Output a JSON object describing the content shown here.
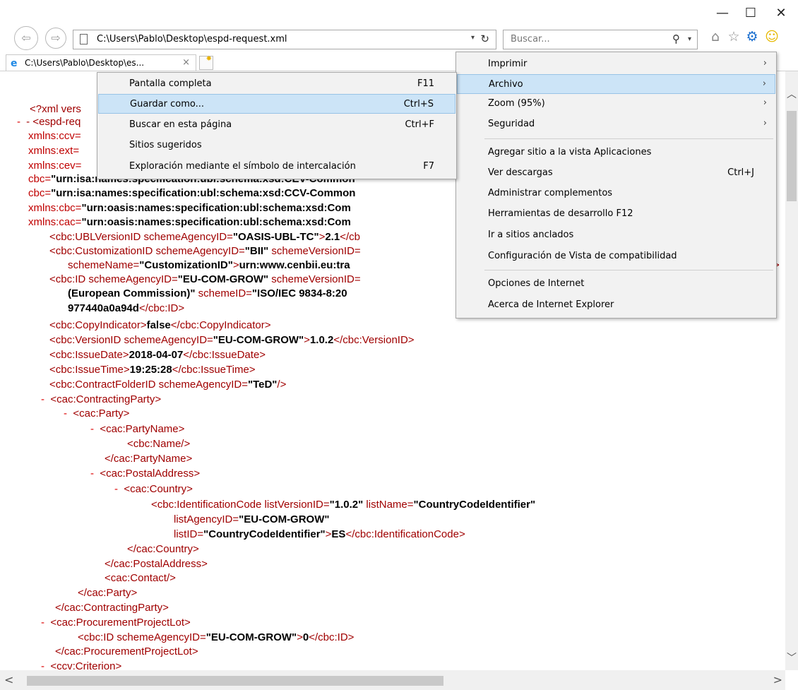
{
  "address_bar": {
    "url": "C:\\Users\\Pablo\\Desktop\\espd-request.xml"
  },
  "search": {
    "placeholder": "Buscar..."
  },
  "tab": {
    "title": "C:\\Users\\Pablo\\Desktop\\es...",
    "close": "×"
  },
  "window": {
    "minimize": "—",
    "maximize": "☐",
    "close": "✕"
  },
  "icons": {
    "back": "⇦",
    "forward": "⇨",
    "refresh": "↻",
    "search": "⚲",
    "dropdown": "▾",
    "home": "⌂",
    "favorites": "☆",
    "tools": "⚙",
    "feedback": "☺"
  },
  "colors": {
    "tag": "#990000",
    "attr": "#c00000",
    "menu_highlight": "#cce4f7"
  },
  "tools_menu": [
    {
      "label": "Imprimir",
      "submenu": true
    },
    {
      "label": "Archivo",
      "submenu": true,
      "highlighted": true
    },
    {
      "label": "Zoom (95%)",
      "submenu": true
    },
    {
      "label": "Seguridad",
      "submenu": true
    },
    {
      "label": "Agregar sitio a la vista Aplicaciones"
    },
    {
      "label": "Ver descargas",
      "shortcut": "Ctrl+J"
    },
    {
      "label": "Administrar complementos"
    },
    {
      "label": "Herramientas de desarrollo F12"
    },
    {
      "label": "Ir a sitios anclados"
    },
    {
      "label": "Configuración de Vista de compatibilidad"
    },
    {
      "label": "Opciones de Internet"
    },
    {
      "label": "Acerca de Internet Explorer"
    }
  ],
  "file_submenu": [
    {
      "label": "Pantalla completa",
      "shortcut": "F11"
    },
    {
      "label": "Guardar como...",
      "shortcut": "Ctrl+S",
      "highlighted": true
    },
    {
      "label": "Buscar en esta página",
      "shortcut": "Ctrl+F"
    },
    {
      "label": "Sitios sugeridos"
    },
    {
      "label": "Exploración mediante el símbolo de intercalación",
      "shortcut": "F7"
    }
  ],
  "xml": {
    "l01": "<?xml vers",
    "l02": "- <espd-req",
    "l03": "xmlns:ccv=",
    "l04": "xmlns:ext=",
    "l05": "xmlns:cev=",
    "l06a": "cbc=",
    "l06b": "\"urn:isa:names:specification:ubl:schema:xsd:CEV-Common",
    "l07a": "cbc=",
    "l07b": "\"urn:isa:names:specification:ubl:schema:xsd:CCV-Common",
    "l08a": "xmlns:cbc=",
    "l08b": "\"urn:oasis:names:specification:ubl:schema:xsd:Com",
    "l09a": "xmlns:cac=",
    "l09b": "\"urn:oasis:names:specification:ubl:schema:xsd:Com",
    "l10a": "<cbc:UBLVersionID schemeAgencyID=",
    "l10b": "\"OASIS-UBL-TC\"",
    "l10c": ">",
    "l10d": "2.1",
    "l10e": "</cb",
    "l11a": "<cbc:CustomizationID schemeAgencyID=",
    "l11b": "\"BII\"",
    "l11c": " schemeVersionID=",
    "l12a": "schemeName=",
    "l12b": "\"CustomizationID\"",
    "l12c": ">",
    "l12d": "urn:www.cenbii.eu:tra",
    "l13a": "<cbc:ID schemeAgencyID=",
    "l13b": "\"EU-COM-GROW\"",
    "l13c": " schemeVersionID=",
    "l14a": "(European Commission)\"",
    "l14b": " schemeID=",
    "l14c": "\"ISO/IEC 9834-8:20",
    "l15a": "977440a0a94d",
    "l15b": "</cbc:ID>",
    "l16a": "<cbc:CopyIndicator>",
    "l16b": "false",
    "l16c": "</cbc:CopyIndicator>",
    "l17a": "<cbc:VersionID schemeAgencyID=",
    "l17b": "\"EU-COM-GROW\"",
    "l17c": ">",
    "l17d": "1.0.2",
    "l17e": "</cbc:VersionID>",
    "l18a": "<cbc:IssueDate>",
    "l18b": "2018-04-07",
    "l18c": "</cbc:IssueDate>",
    "l19a": "<cbc:IssueTime>",
    "l19b": "19:25:28",
    "l19c": "</cbc:IssueTime>",
    "l20a": "<cbc:ContractFolderID schemeAgencyID=",
    "l20b": "\"TeD\"",
    "l20c": "/>",
    "l21": "<cac:ContractingParty>",
    "l22": "<cac:Party>",
    "l23": "<cac:PartyName>",
    "l24": "<cbc:Name/>",
    "l25": "</cac:PartyName>",
    "l26": "<cac:PostalAddress>",
    "l27": "<cac:Country>",
    "l28a": "<cbc:IdentificationCode listVersionID=",
    "l28b": "\"1.0.2\"",
    "l28c": " listName=",
    "l28d": "\"CountryCodeIdentifier\"",
    "l29a": "listAgencyID=",
    "l29b": "\"EU-COM-GROW\"",
    "l30a": "listID=",
    "l30b": "\"CountryCodeIdentifier\"",
    "l30c": ">",
    "l30d": "ES",
    "l30e": "</cbc:IdentificationCode>",
    "l31": "</cac:Country>",
    "l32": "</cac:PostalAddress>",
    "l33": "<cac:Contact/>",
    "l34": "</cac:Party>",
    "l35": "</cac:ContractingParty>",
    "l36": "<cac:ProcurementProjectLot>",
    "l37a": "<cbc:ID schemeAgencyID=",
    "l37b": "\"EU-COM-GROW\"",
    "l37c": ">",
    "l37d": "0",
    "l37e": "</cbc:ID>",
    "l38": "</cac:ProcurementProjectLot>",
    "l39": "<ccv:Criterion>",
    "minus": "-"
  }
}
